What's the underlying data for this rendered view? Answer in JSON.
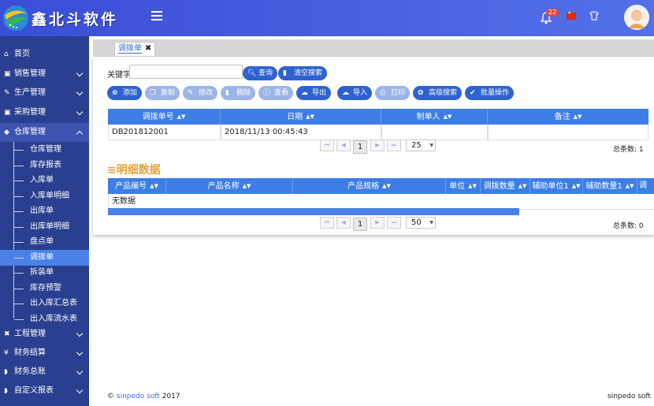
{
  "header": {
    "logo_text": "鑫北斗软件",
    "notification_count": "22"
  },
  "sidebar": {
    "items": [
      {
        "label": "首页",
        "icon": "home-icon"
      },
      {
        "label": "销售管理",
        "icon": "cart-icon"
      },
      {
        "label": "生产管理",
        "icon": "wrench-icon"
      },
      {
        "label": "采购管理",
        "icon": "cart-icon"
      },
      {
        "label": "仓库管理",
        "icon": "cube-icon"
      },
      {
        "label": "工程管理",
        "icon": "tools-icon"
      },
      {
        "label": "财务结算",
        "icon": "yen-icon"
      },
      {
        "label": "财务总账",
        "icon": "tag-icon"
      },
      {
        "label": "自定义报表",
        "icon": "tag-icon"
      }
    ],
    "warehouse_subitems": [
      "仓库管理",
      "库存报表",
      "入库单",
      "入库单明细",
      "出库单",
      "出库单明细",
      "盘点单",
      "调拨单",
      "拆装单",
      "库存预警",
      "出入库汇总表",
      "出入库流水表"
    ]
  },
  "tab": {
    "label": "调拨单",
    "close": "✖"
  },
  "search": {
    "keyword_label": "关键字",
    "query_button": "查询",
    "clear_button": "清空搜索"
  },
  "toolbar": {
    "add": "添加",
    "copy": "复制",
    "edit": "修改",
    "delete": "删除",
    "view": "查看",
    "export": "导出",
    "import": "导入",
    "print": "打印",
    "advanced_search": "高级搜索",
    "batch": "批量操作"
  },
  "main_grid": {
    "columns": [
      "调拨单号",
      "日期",
      "制单人",
      "备注"
    ],
    "rows": [
      {
        "no": "DB201812001",
        "date": "2018/11/13 00:45:43",
        "maker": "",
        "remark": ""
      }
    ],
    "page": "1",
    "page_size": "25",
    "total": "总条数: 1"
  },
  "detail": {
    "title": "明细数据",
    "columns": [
      "产品编号",
      "产品名称",
      "产品规格",
      "单位",
      "调拨数量",
      "辅助单位1",
      "辅助数量1",
      "调"
    ],
    "empty_text": "无数据",
    "page": "1",
    "page_size": "50",
    "total": "总条数: 0"
  },
  "footer": {
    "copyright_prefix": "©",
    "link_text": "sinpedo soft",
    "year": "2017",
    "right_text": "sinpedo soft"
  }
}
